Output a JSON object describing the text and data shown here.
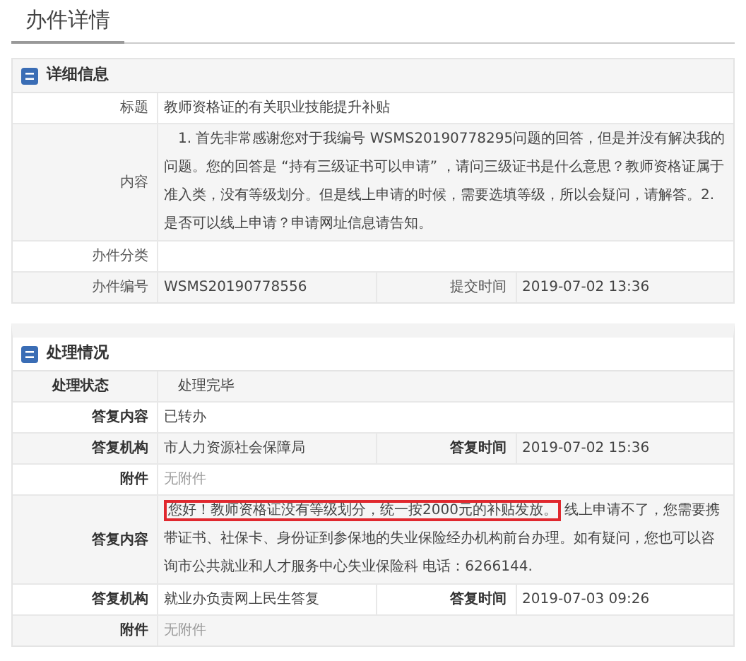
{
  "page_title": "办件详情",
  "sections": [
    {
      "title": "详细信息",
      "bold_labels": false,
      "rows": [
        {
          "kind": "plain",
          "fields": [
            {
              "label": "标题",
              "value": [
                {
                  "text": "教师资格证的有关职业技能提升补贴",
                  "highlighted": false
                }
              ],
              "muted": false
            }
          ]
        },
        {
          "kind": "plain",
          "fields": [
            {
              "label": "内容",
              "value": [
                {
                  "text": "　1. 首先非常感谢您对于我编号  WSMS20190778295问题的回答，但是并没有解决我的问题。您的回答是 “持有三级证书可以申请” ，请问三级证书是什么意思？教师资格证属于准入类，没有等级划分。但是线上申请的时候，需要选填等级，所以会疑问，请解答。2. 是否可以线上申请？申请网址信息请告知。",
                  "highlighted": false
                }
              ],
              "muted": false
            }
          ]
        },
        {
          "kind": "plain",
          "fields": [
            {
              "label": "办件分类"
            }
          ]
        },
        {
          "kind": "plain",
          "fields": [
            {
              "label": "办件编号",
              "value": [
                {
                  "text": "WSMS20190778556",
                  "highlighted": false
                }
              ],
              "muted": false
            },
            {
              "label": "提交时间",
              "value": [
                {
                  "text": "2019-07-02 13:36",
                  "highlighted": false
                }
              ],
              "muted": false
            }
          ]
        }
      ]
    },
    {
      "title": "处理情况",
      "bold_labels": true,
      "rows": [
        {
          "kind": "status",
          "fields": [
            {
              "label": "处理状态",
              "value": [
                {
                  "text": "处理完毕",
                  "highlighted": false
                }
              ],
              "muted": false
            }
          ]
        },
        {
          "kind": "plain",
          "fields": [
            {
              "label": "答复内容",
              "value": [
                {
                  "text": "已转办",
                  "highlighted": false
                }
              ],
              "muted": false
            }
          ]
        },
        {
          "kind": "plain",
          "fields": [
            {
              "label": "答复机构",
              "value": [
                {
                  "text": "市人力资源社会保障局",
                  "highlighted": false
                }
              ],
              "muted": false
            },
            {
              "label": "答复时间",
              "value": [
                {
                  "text": "2019-07-02 15:36",
                  "highlighted": false
                }
              ],
              "muted": false
            }
          ]
        },
        {
          "kind": "plain",
          "fields": [
            {
              "label": "附件",
              "value": [
                {
                  "text": "无附件",
                  "highlighted": false
                }
              ],
              "muted": true
            }
          ]
        },
        {
          "kind": "plain",
          "fields": [
            {
              "label": "答复内容",
              "value": [
                {
                  "text": "您好！教师资格证没有等级划分，统一按2000元的补贴发放。",
                  "highlighted": true
                },
                {
                  "text": "线上申请不了，您需要携带证书、社保卡、身份证到参保地的失业保险经办机构前台办理。如有疑问，您也可以咨询市公共就业和人才服务中心失业保险科 电话：6266144.",
                  "highlighted": false
                }
              ],
              "muted": false
            }
          ]
        },
        {
          "kind": "plain",
          "fields": [
            {
              "label": "答复机构",
              "value": [
                {
                  "text": "就业办负责网上民生答复",
                  "highlighted": false
                }
              ],
              "muted": false
            },
            {
              "label": "答复时间",
              "value": [
                {
                  "text": "2019-07-03 09:26",
                  "highlighted": false
                }
              ],
              "muted": false
            }
          ]
        },
        {
          "kind": "plain",
          "fields": [
            {
              "label": "附件",
              "value": [
                {
                  "text": "无附件",
                  "highlighted": false
                }
              ],
              "muted": true
            }
          ]
        }
      ]
    }
  ]
}
